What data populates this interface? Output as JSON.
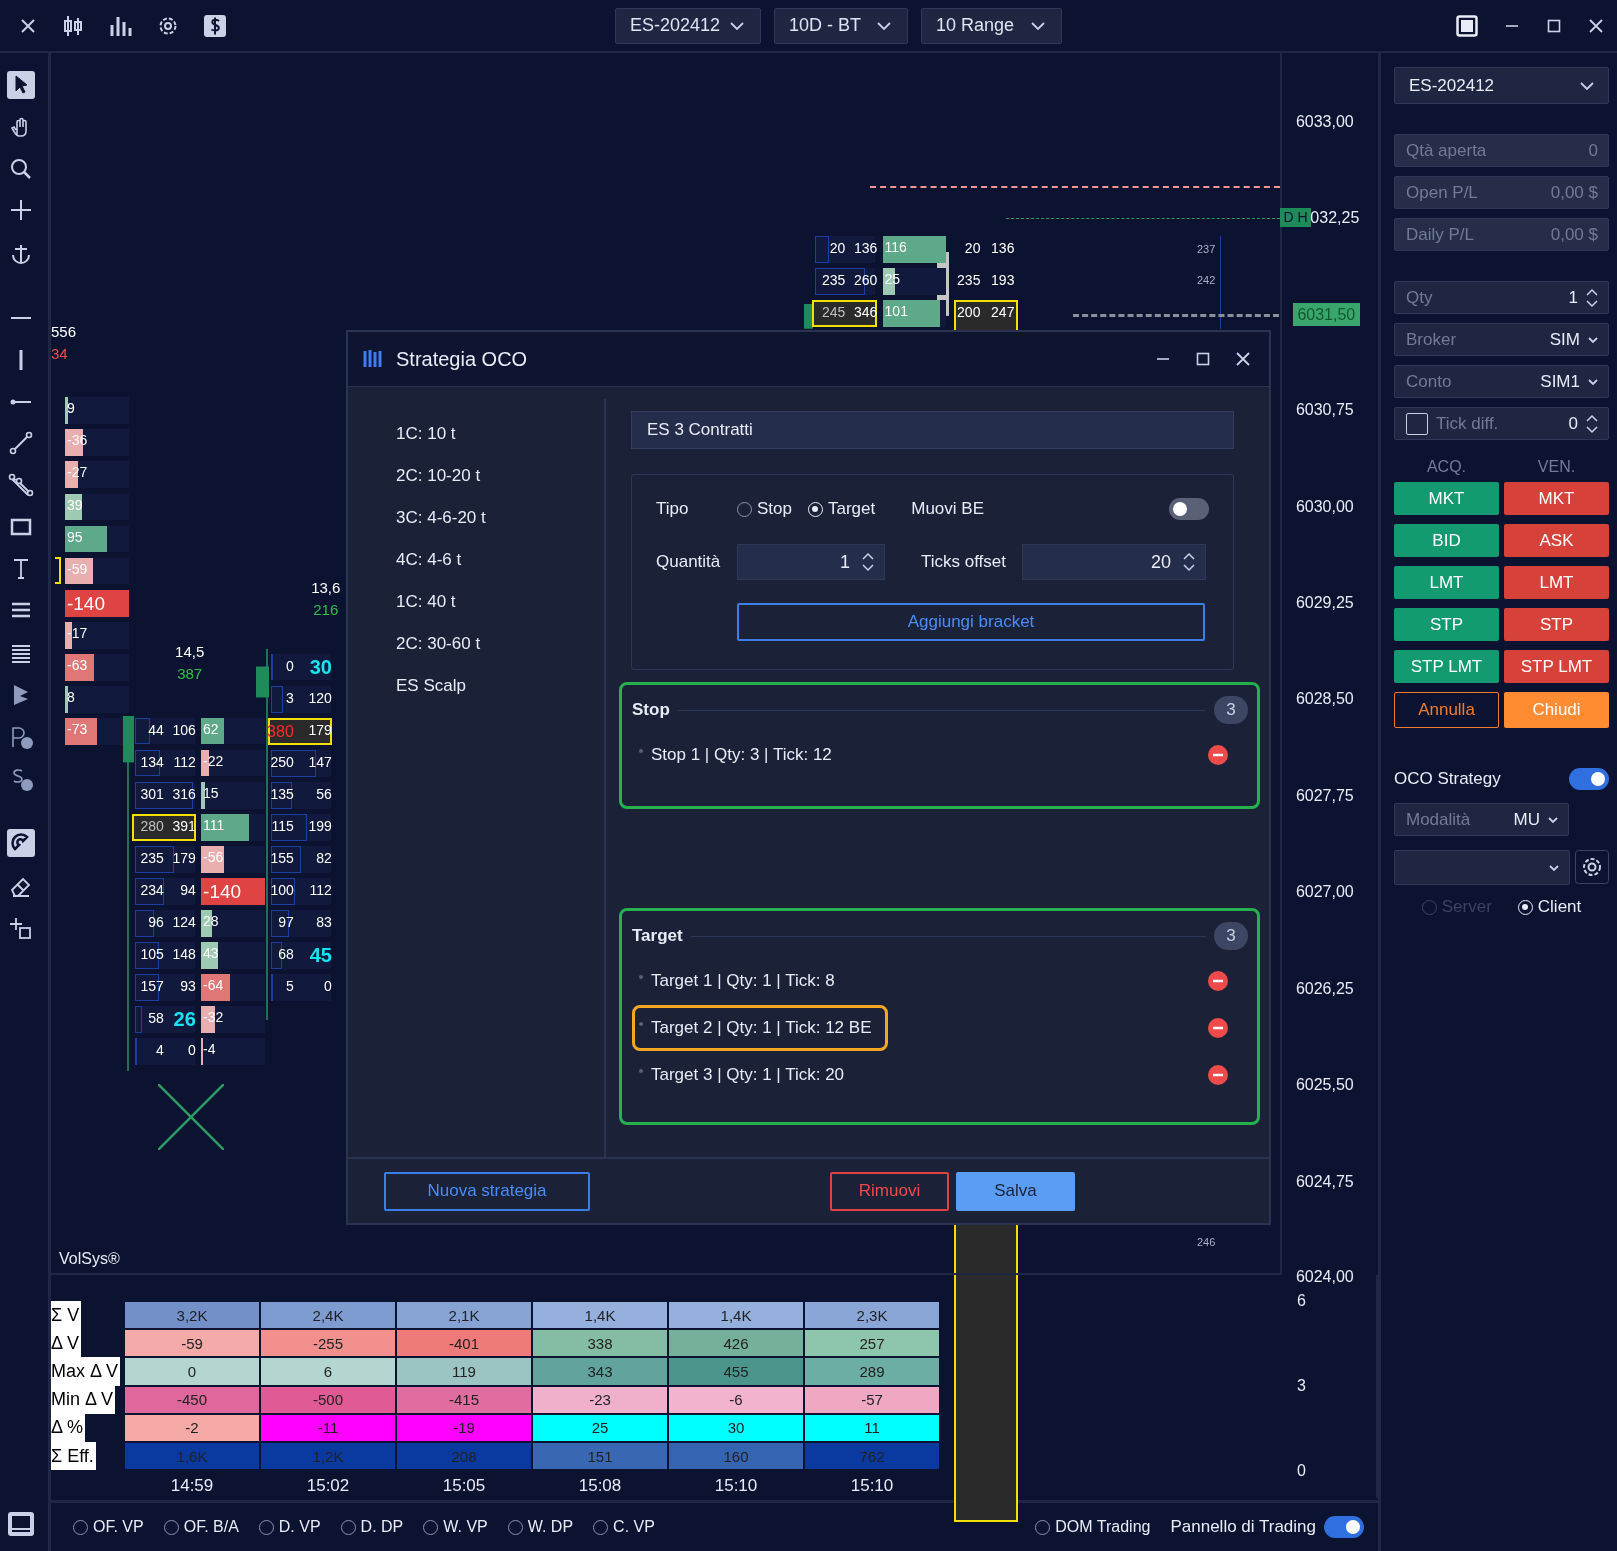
{
  "top_bar": {
    "selectors": [
      "ES-202412",
      "10D - BT",
      "10 Range"
    ]
  },
  "chart": {
    "price_axis": [
      "6033,00",
      "032,25",
      "6030,75",
      "6030,00",
      "6029,25",
      "6028,50",
      "6027,75",
      "6027,00",
      "6026,25",
      "6025,50",
      "6024,75",
      "6024,00"
    ],
    "current_price": "6031,50",
    "level_tag": "D H",
    "column_a": {
      "header": [
        "556",
        "34"
      ],
      "deltas": [
        {
          "value": "9",
          "color": "#9ec9b2",
          "level": 0.05
        },
        {
          "value": "-36",
          "color": "#e8aeb0",
          "level": 0.29
        },
        {
          "value": "-27",
          "color": "#e8aeb0",
          "level": 0.2
        },
        {
          "value": "39",
          "color": "#9ec9b2",
          "level": 0.27
        },
        {
          "value": "95",
          "color": "#5ea98a",
          "level": 0.66
        },
        {
          "value": "-59",
          "color": "#e8aeb0",
          "level": 0.44
        },
        {
          "value": "-140",
          "color": "#e04343",
          "level": 1
        },
        {
          "value": "-17",
          "color": "#e8aeb0",
          "level": 0.11
        },
        {
          "value": "-63",
          "color": "#e07777",
          "level": 0.45
        },
        {
          "value": "8",
          "color": "#9ec9b2",
          "level": 0.05
        },
        {
          "value": "-73",
          "color": "#e07777",
          "level": 0.5
        }
      ]
    },
    "columns": [
      {
        "header": [
          "14,5",
          "387"
        ],
        "rows": [
          {
            "bid": "44",
            "ask": "106",
            "kind": "normal",
            "level": 0.25,
            "delta": {
              "value": "62",
              "color": "#5ea98a",
              "level": 0.36
            }
          },
          {
            "bid": "134",
            "ask": "112",
            "kind": "normal",
            "level": 0.42,
            "delta": {
              "value": "-22",
              "color": "#e8aeb0",
              "level": 0.13
            }
          },
          {
            "bid": "301",
            "ask": "316",
            "kind": "normal",
            "level": 0.97,
            "delta": {
              "value": "15",
              "color": "#9ec9b2",
              "level": 0.06
            }
          },
          {
            "bid": "280",
            "ask": "391",
            "kind": "poc",
            "level": 1,
            "delta": {
              "value": "111",
              "color": "#5ea98a",
              "level": 0.75
            }
          },
          {
            "bid": "235",
            "ask": "179",
            "kind": "normal",
            "level": 0.65,
            "delta": {
              "value": "-56",
              "color": "#e8aeb0",
              "level": 0.36
            }
          },
          {
            "bid": "234",
            "ask": "94",
            "kind": "normal",
            "level": 0.48,
            "delta": {
              "value": "-140",
              "color": "#e04343",
              "level": 1
            }
          },
          {
            "bid": "96",
            "ask": "124",
            "kind": "normal",
            "level": 0.32,
            "delta": {
              "value": "28",
              "color": "#9ec9b2",
              "level": 0.17
            }
          },
          {
            "bid": "105",
            "ask": "148",
            "kind": "normal",
            "level": 0.4,
            "delta": {
              "value": "43",
              "color": "#9ec9b2",
              "level": 0.27
            }
          },
          {
            "bid": "157",
            "ask": "93",
            "kind": "normal",
            "level": 0.4,
            "delta": {
              "value": "-64",
              "color": "#e07777",
              "level": 0.45
            }
          },
          {
            "bid": "58",
            "ask": "26",
            "kind": "max",
            "level": 0.12,
            "delta": {
              "value": "-32",
              "color": "#e8aeb0",
              "level": 0.22
            }
          },
          {
            "bid": "4",
            "ask": "0",
            "kind": "normal",
            "level": 0.03,
            "delta": {
              "value": "-4",
              "color": "#e8aeb0",
              "level": 0.03
            }
          }
        ]
      },
      {
        "header": [
          "13,6",
          "216"
        ],
        "rows": [
          {
            "bid": "0",
            "ask": "30",
            "kind": "max",
            "level": 0.03
          },
          {
            "bid": "3",
            "ask": "120",
            "kind": "normal",
            "level": 0.2
          },
          {
            "bid": "380",
            "ask": "179",
            "kind": "poc_alert",
            "level": 1
          },
          {
            "bid": "250",
            "ask": "147",
            "kind": "normal",
            "level": 0.75
          },
          {
            "bid": "135",
            "ask": "56",
            "kind": "normal",
            "level": 0.35
          },
          {
            "bid": "115",
            "ask": "199",
            "kind": "normal",
            "level": 0.6
          },
          {
            "bid": "155",
            "ask": "82",
            "kind": "normal",
            "level": 0.5
          },
          {
            "bid": "100",
            "ask": "112",
            "kind": "normal",
            "level": 0.4
          },
          {
            "bid": "97",
            "ask": "83",
            "kind": "normal",
            "level": 0.3
          },
          {
            "bid": "68",
            "ask": "45",
            "kind": "max",
            "level": 0.18
          },
          {
            "bid": "5",
            "ask": "0",
            "kind": "normal",
            "level": 0.03
          }
        ]
      },
      {
        "rows": [
          {
            "bid": "20",
            "ask": "136",
            "kind": "normal",
            "level": 0.22,
            "delta": {
              "value": "116",
              "color": "#5ea98a",
              "level": 1
            }
          },
          {
            "bid": "235",
            "ask": "260",
            "kind": "normal",
            "level": 0.83,
            "delta": {
              "value": "25",
              "color": "#9ec9b2",
              "level": 0.2
            }
          },
          {
            "bid": "245",
            "ask": "346",
            "kind": "poc",
            "level": 1,
            "delta": {
              "value": "101",
              "color": "#5ea98a",
              "level": 0.9
            }
          }
        ]
      }
    ],
    "column_d_right": [
      {
        "bid": "20",
        "ask": "136",
        "kind": "normal"
      },
      {
        "bid": "235",
        "ask": "193",
        "kind": "normal"
      },
      {
        "bid": "200",
        "ask": "247",
        "kind": "poc"
      }
    ],
    "side_values": [
      "237",
      "242"
    ],
    "bottom_value": "246",
    "study_label": "VolSys®"
  },
  "volsys_table": {
    "rows": [
      {
        "label": "Σ V",
        "cells": [
          {
            "value": "3,2K",
            "color": "#7390c8"
          },
          {
            "value": "2,4K",
            "color": "#7e9ccf"
          },
          {
            "value": "2,1K",
            "color": "#86a3d4"
          },
          {
            "value": "1,4K",
            "color": "#95b0dc"
          },
          {
            "value": "1,4K",
            "color": "#95b0dc"
          },
          {
            "value": "2,3K",
            "color": "#8aa6d6"
          }
        ]
      },
      {
        "label": "Δ V",
        "cells": [
          {
            "value": "-59",
            "color": "#f4aaa8"
          },
          {
            "value": "-255",
            "color": "#f2908e"
          },
          {
            "value": "-401",
            "color": "#ef7a7a"
          },
          {
            "value": "338",
            "color": "#84bca4"
          },
          {
            "value": "426",
            "color": "#74b09a"
          },
          {
            "value": "257",
            "color": "#8ec5ad"
          }
        ]
      },
      {
        "label": "Max Δ V",
        "cells": [
          {
            "value": "0",
            "color": "#b4d6d0"
          },
          {
            "value": "6",
            "color": "#b4d6d0"
          },
          {
            "value": "119",
            "color": "#9cc4c2"
          },
          {
            "value": "343",
            "color": "#62a39d"
          },
          {
            "value": "455",
            "color": "#4b958d"
          },
          {
            "value": "289",
            "color": "#6cada4"
          }
        ]
      },
      {
        "label": "Min Δ V",
        "cells": [
          {
            "value": "-450",
            "color": "#e0679b"
          },
          {
            "value": "-500",
            "color": "#e05b96"
          },
          {
            "value": "-415",
            "color": "#e06d9f"
          },
          {
            "value": "-23",
            "color": "#f0b0cc"
          },
          {
            "value": "-6",
            "color": "#f2b3cf"
          },
          {
            "value": "-57",
            "color": "#efa7c3"
          }
        ]
      },
      {
        "label": "Δ %",
        "cells": [
          {
            "value": "-2",
            "color": "#f5aaa8"
          },
          {
            "value": "-11",
            "color": "#ff00ff"
          },
          {
            "value": "-19",
            "color": "#ff00ff"
          },
          {
            "value": "25",
            "color": "#00ffff"
          },
          {
            "value": "30",
            "color": "#00ffff"
          },
          {
            "value": "11",
            "color": "#00ffff"
          }
        ]
      },
      {
        "label": "Σ Eff.",
        "cells": [
          {
            "value": "1,6K",
            "color": "#0a3aa0"
          },
          {
            "value": "1,2K",
            "color": "#0a3aa0"
          },
          {
            "value": "208",
            "color": "#0a3aa0"
          },
          {
            "value": "151",
            "color": "#3a67b4"
          },
          {
            "value": "160",
            "color": "#3565b2"
          },
          {
            "value": "762",
            "color": "#0a3aa0"
          }
        ]
      }
    ],
    "times": [
      "14:59",
      "15:02",
      "15:05",
      "15:08",
      "15:10",
      "15:10"
    ],
    "axis": [
      "6",
      "3",
      "0"
    ]
  },
  "bottom_bar": {
    "options": [
      {
        "label": "OF. VP",
        "selected": false
      },
      {
        "label": "OF. B/A",
        "selected": false
      },
      {
        "label": "D. VP",
        "selected": false
      },
      {
        "label": "D. DP",
        "selected": false
      },
      {
        "label": "W. VP",
        "selected": false
      },
      {
        "label": "W. DP",
        "selected": false
      },
      {
        "label": "C. VP",
        "selected": false
      }
    ],
    "dom_trading": {
      "label": "DOM Trading",
      "selected": false
    },
    "trading_panel": {
      "label": "Pannello di Trading",
      "on": true
    }
  },
  "trading_panel": {
    "instrument": "ES-202412",
    "readouts": [
      {
        "label": "Qtà aperta",
        "value": "0"
      },
      {
        "label": "Open P/L",
        "value": "0,00 $"
      },
      {
        "label": "Daily P/L",
        "value": "0,00 $"
      }
    ],
    "qty": {
      "label": "Qty",
      "value": "1"
    },
    "broker": {
      "label": "Broker",
      "value": "SIM"
    },
    "account": {
      "label": "Conto",
      "value": "SIM1"
    },
    "tick_diff": {
      "label": "Tick diff.",
      "checked": false,
      "value": "0"
    },
    "buy_heading": "ACQ.",
    "sell_heading": "VEN.",
    "buy_buttons": [
      "MKT",
      "BID",
      "LMT",
      "STP",
      "STP LMT"
    ],
    "sell_buttons": [
      "MKT",
      "ASK",
      "LMT",
      "STP",
      "STP LMT"
    ],
    "cancel": "Annulla",
    "close": "Chiudi",
    "oco": {
      "label": "OCO Strategy",
      "on": true
    },
    "mode": {
      "label": "Modalità",
      "value": "MU"
    },
    "connection": [
      {
        "label": "Server",
        "selected": false,
        "disabled": true
      },
      {
        "label": "Client",
        "selected": true,
        "disabled": false
      }
    ]
  },
  "dialog": {
    "title": "Strategia OCO",
    "strategies": [
      "1C: 10 t",
      "2C: 10-20 t",
      "3C: 4-6-20 t",
      "4C: 4-6 t",
      "1C: 40 t",
      "2C: 30-60 t",
      "ES Scalp"
    ],
    "name": "ES 3 Contratti",
    "type": {
      "label": "Tipo",
      "options": [
        {
          "label": "Stop",
          "selected": false
        },
        {
          "label": "Target",
          "selected": true
        }
      ]
    },
    "move_be": {
      "label": "Muovi BE",
      "on": false
    },
    "quantity": {
      "label": "Quantità",
      "value": "1"
    },
    "ticks_offset": {
      "label": "Ticks offset",
      "value": "20"
    },
    "add_button": "Aggiungi bracket",
    "groups": [
      {
        "title": "Stop",
        "count": "3",
        "items": [
          {
            "text": "Stop 1 | Qty: 3 | Tick: 12",
            "highlighted": false
          }
        ]
      },
      {
        "title": "Target",
        "count": "3",
        "items": [
          {
            "text": "Target 1 | Qty: 1 | Tick: 8",
            "highlighted": false
          },
          {
            "text": "Target 2 | Qty: 1 | Tick: 12 BE",
            "highlighted": true
          },
          {
            "text": "Target 3 | Qty: 1 | Tick: 20",
            "highlighted": false
          }
        ]
      }
    ],
    "new_button": "Nuova strategia",
    "remove_button": "Rimuovi",
    "save_button": "Salva"
  }
}
